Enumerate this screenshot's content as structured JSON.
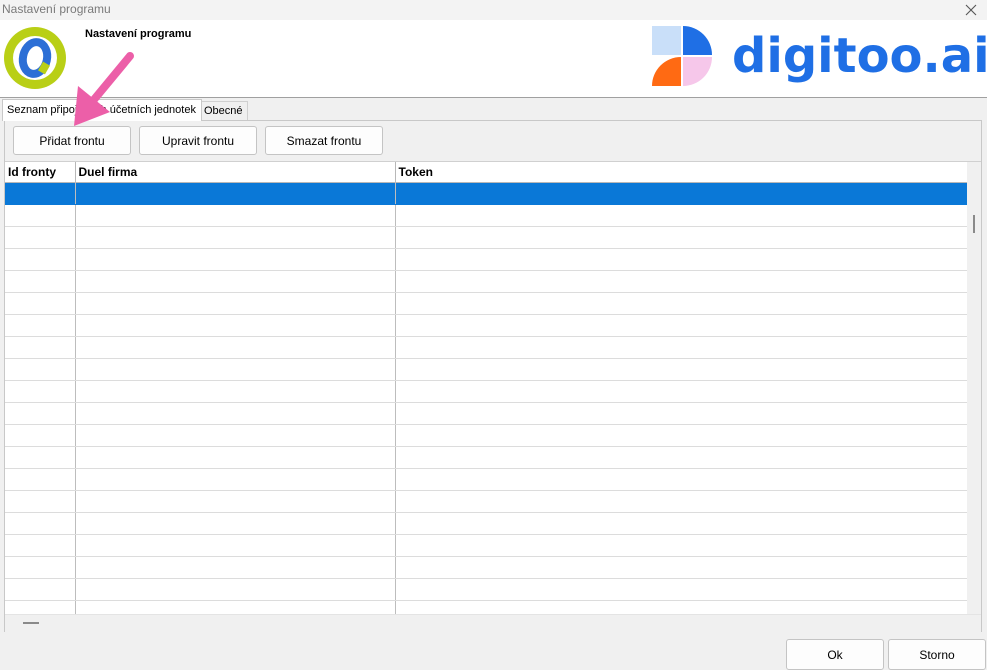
{
  "window": {
    "title": "Nastavení programu",
    "close_glyph": "✕"
  },
  "header": {
    "title": "Nastavení programu",
    "app_logo_icon": "duel-logo-icon",
    "brand_text": "digitoo.ai",
    "colors": {
      "brand_blue": "#1f6fe5",
      "logo_green": "#b9cf16",
      "logo_blue": "#2c6fd6"
    }
  },
  "tabs": [
    {
      "label": "Seznam připojených účetních jednotek",
      "active": true
    },
    {
      "label": "Obecné",
      "active": false
    }
  ],
  "toolbar": {
    "add_label": "Přidat frontu",
    "edit_label": "Upravit frontu",
    "delete_label": "Smazat frontu"
  },
  "grid": {
    "columns": [
      "Id fronty",
      "Duel firma",
      "Token"
    ],
    "selected_row": 0,
    "rows": [
      [
        "",
        "",
        ""
      ],
      [
        "",
        "",
        ""
      ],
      [
        "",
        "",
        ""
      ],
      [
        "",
        "",
        ""
      ],
      [
        "",
        "",
        ""
      ],
      [
        "",
        "",
        ""
      ],
      [
        "",
        "",
        ""
      ],
      [
        "",
        "",
        ""
      ],
      [
        "",
        "",
        ""
      ],
      [
        "",
        "",
        ""
      ],
      [
        "",
        "",
        ""
      ],
      [
        "",
        "",
        ""
      ],
      [
        "",
        "",
        ""
      ],
      [
        "",
        "",
        ""
      ],
      [
        "",
        "",
        ""
      ],
      [
        "",
        "",
        ""
      ],
      [
        "",
        "",
        ""
      ],
      [
        "",
        "",
        ""
      ],
      [
        "",
        "",
        ""
      ],
      [
        "",
        "",
        ""
      ]
    ],
    "selection_color": "#0a78d7"
  },
  "footer": {
    "ok_label": "Ok",
    "cancel_label": "Storno"
  },
  "annotation": {
    "arrow_color": "#ec5fa8",
    "arrow_icon": "pink-arrow-icon"
  }
}
